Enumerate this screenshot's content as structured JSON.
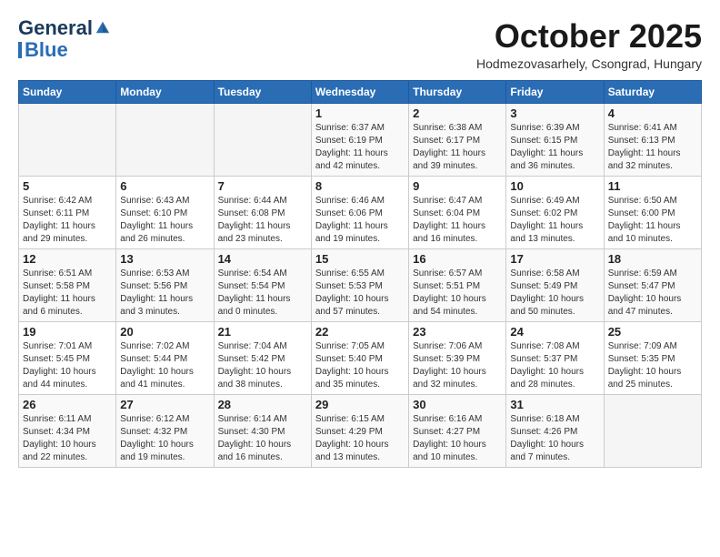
{
  "header": {
    "logo_general": "General",
    "logo_blue": "Blue",
    "month_title": "October 2025",
    "subtitle": "Hodmezovasarhely, Csongrad, Hungary"
  },
  "weekdays": [
    "Sunday",
    "Monday",
    "Tuesday",
    "Wednesday",
    "Thursday",
    "Friday",
    "Saturday"
  ],
  "weeks": [
    [
      {
        "day": "",
        "content": ""
      },
      {
        "day": "",
        "content": ""
      },
      {
        "day": "",
        "content": ""
      },
      {
        "day": "1",
        "content": "Sunrise: 6:37 AM\nSunset: 6:19 PM\nDaylight: 11 hours\nand 42 minutes."
      },
      {
        "day": "2",
        "content": "Sunrise: 6:38 AM\nSunset: 6:17 PM\nDaylight: 11 hours\nand 39 minutes."
      },
      {
        "day": "3",
        "content": "Sunrise: 6:39 AM\nSunset: 6:15 PM\nDaylight: 11 hours\nand 36 minutes."
      },
      {
        "day": "4",
        "content": "Sunrise: 6:41 AM\nSunset: 6:13 PM\nDaylight: 11 hours\nand 32 minutes."
      }
    ],
    [
      {
        "day": "5",
        "content": "Sunrise: 6:42 AM\nSunset: 6:11 PM\nDaylight: 11 hours\nand 29 minutes."
      },
      {
        "day": "6",
        "content": "Sunrise: 6:43 AM\nSunset: 6:10 PM\nDaylight: 11 hours\nand 26 minutes."
      },
      {
        "day": "7",
        "content": "Sunrise: 6:44 AM\nSunset: 6:08 PM\nDaylight: 11 hours\nand 23 minutes."
      },
      {
        "day": "8",
        "content": "Sunrise: 6:46 AM\nSunset: 6:06 PM\nDaylight: 11 hours\nand 19 minutes."
      },
      {
        "day": "9",
        "content": "Sunrise: 6:47 AM\nSunset: 6:04 PM\nDaylight: 11 hours\nand 16 minutes."
      },
      {
        "day": "10",
        "content": "Sunrise: 6:49 AM\nSunset: 6:02 PM\nDaylight: 11 hours\nand 13 minutes."
      },
      {
        "day": "11",
        "content": "Sunrise: 6:50 AM\nSunset: 6:00 PM\nDaylight: 11 hours\nand 10 minutes."
      }
    ],
    [
      {
        "day": "12",
        "content": "Sunrise: 6:51 AM\nSunset: 5:58 PM\nDaylight: 11 hours\nand 6 minutes."
      },
      {
        "day": "13",
        "content": "Sunrise: 6:53 AM\nSunset: 5:56 PM\nDaylight: 11 hours\nand 3 minutes."
      },
      {
        "day": "14",
        "content": "Sunrise: 6:54 AM\nSunset: 5:54 PM\nDaylight: 11 hours\nand 0 minutes."
      },
      {
        "day": "15",
        "content": "Sunrise: 6:55 AM\nSunset: 5:53 PM\nDaylight: 10 hours\nand 57 minutes."
      },
      {
        "day": "16",
        "content": "Sunrise: 6:57 AM\nSunset: 5:51 PM\nDaylight: 10 hours\nand 54 minutes."
      },
      {
        "day": "17",
        "content": "Sunrise: 6:58 AM\nSunset: 5:49 PM\nDaylight: 10 hours\nand 50 minutes."
      },
      {
        "day": "18",
        "content": "Sunrise: 6:59 AM\nSunset: 5:47 PM\nDaylight: 10 hours\nand 47 minutes."
      }
    ],
    [
      {
        "day": "19",
        "content": "Sunrise: 7:01 AM\nSunset: 5:45 PM\nDaylight: 10 hours\nand 44 minutes."
      },
      {
        "day": "20",
        "content": "Sunrise: 7:02 AM\nSunset: 5:44 PM\nDaylight: 10 hours\nand 41 minutes."
      },
      {
        "day": "21",
        "content": "Sunrise: 7:04 AM\nSunset: 5:42 PM\nDaylight: 10 hours\nand 38 minutes."
      },
      {
        "day": "22",
        "content": "Sunrise: 7:05 AM\nSunset: 5:40 PM\nDaylight: 10 hours\nand 35 minutes."
      },
      {
        "day": "23",
        "content": "Sunrise: 7:06 AM\nSunset: 5:39 PM\nDaylight: 10 hours\nand 32 minutes."
      },
      {
        "day": "24",
        "content": "Sunrise: 7:08 AM\nSunset: 5:37 PM\nDaylight: 10 hours\nand 28 minutes."
      },
      {
        "day": "25",
        "content": "Sunrise: 7:09 AM\nSunset: 5:35 PM\nDaylight: 10 hours\nand 25 minutes."
      }
    ],
    [
      {
        "day": "26",
        "content": "Sunrise: 6:11 AM\nSunset: 4:34 PM\nDaylight: 10 hours\nand 22 minutes."
      },
      {
        "day": "27",
        "content": "Sunrise: 6:12 AM\nSunset: 4:32 PM\nDaylight: 10 hours\nand 19 minutes."
      },
      {
        "day": "28",
        "content": "Sunrise: 6:14 AM\nSunset: 4:30 PM\nDaylight: 10 hours\nand 16 minutes."
      },
      {
        "day": "29",
        "content": "Sunrise: 6:15 AM\nSunset: 4:29 PM\nDaylight: 10 hours\nand 13 minutes."
      },
      {
        "day": "30",
        "content": "Sunrise: 6:16 AM\nSunset: 4:27 PM\nDaylight: 10 hours\nand 10 minutes."
      },
      {
        "day": "31",
        "content": "Sunrise: 6:18 AM\nSunset: 4:26 PM\nDaylight: 10 hours\nand 7 minutes."
      },
      {
        "day": "",
        "content": ""
      }
    ]
  ]
}
